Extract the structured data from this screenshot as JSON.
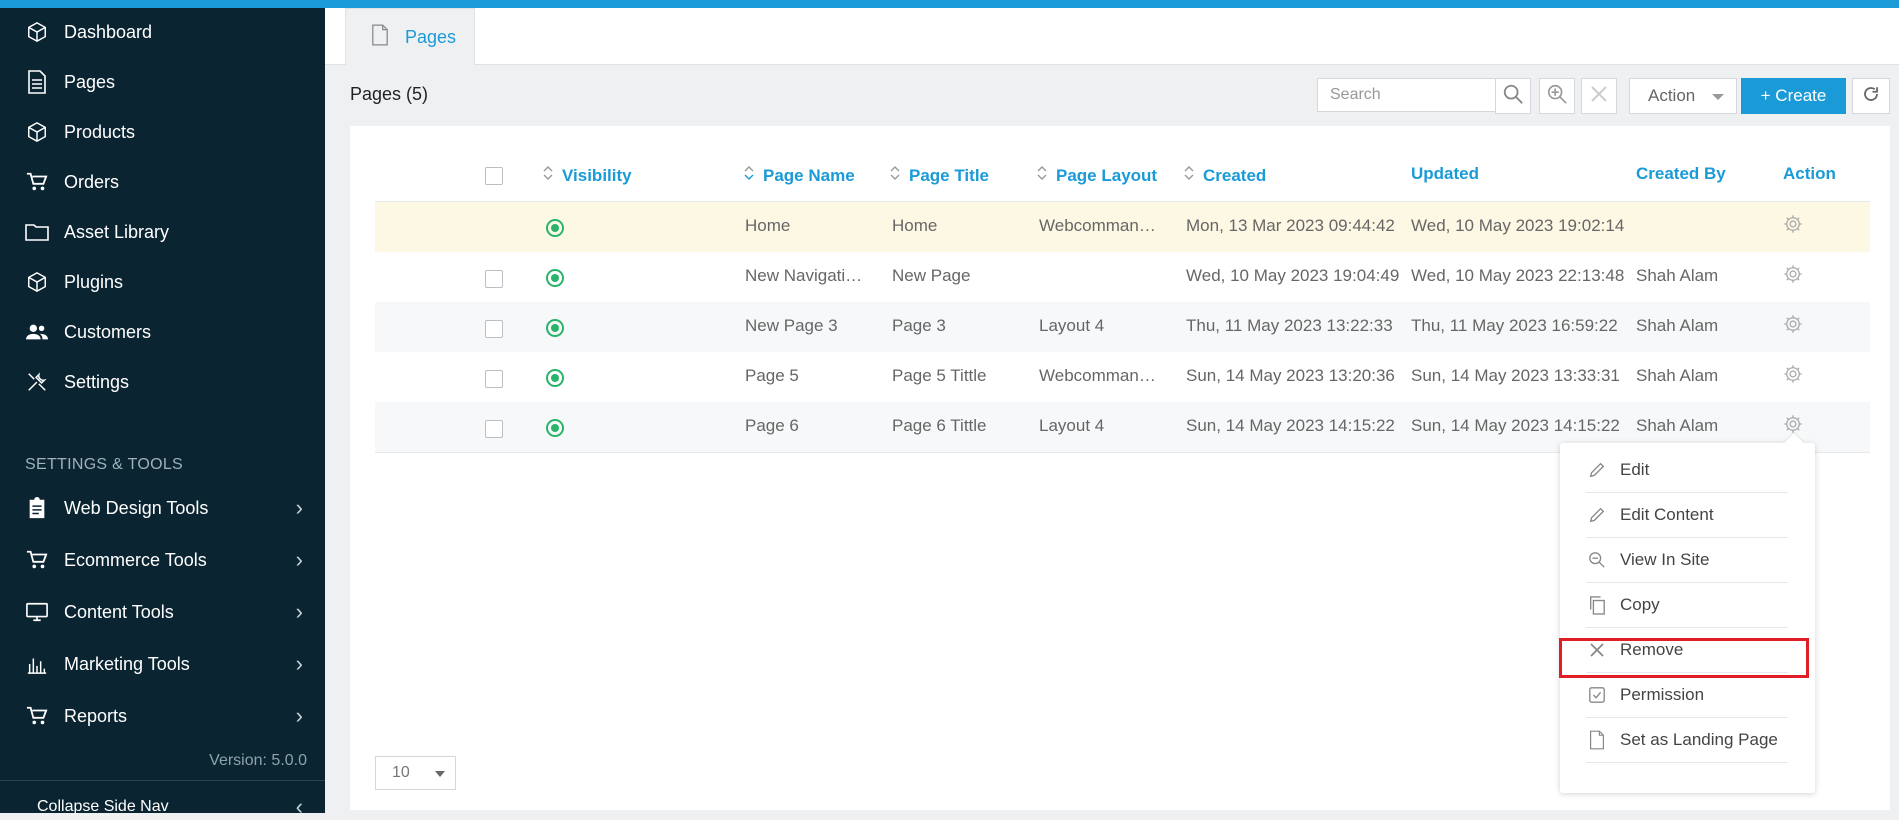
{
  "sidebar": {
    "items": [
      {
        "label": "Dashboard",
        "icon": "cube-icon"
      },
      {
        "label": "Pages",
        "icon": "page-icon"
      },
      {
        "label": "Products",
        "icon": "box-icon"
      },
      {
        "label": "Orders",
        "icon": "cart-icon"
      },
      {
        "label": "Asset Library",
        "icon": "folder-icon"
      },
      {
        "label": "Plugins",
        "icon": "cube-icon"
      },
      {
        "label": "Customers",
        "icon": "users-icon"
      },
      {
        "label": "Settings",
        "icon": "tools-icon"
      }
    ],
    "section_title": "SETTINGS & TOOLS",
    "tools": [
      {
        "label": "Web Design Tools",
        "icon": "clipboard-icon"
      },
      {
        "label": "Ecommerce Tools",
        "icon": "cart-icon"
      },
      {
        "label": "Content Tools",
        "icon": "monitor-icon"
      },
      {
        "label": "Marketing Tools",
        "icon": "chart-icon"
      },
      {
        "label": "Reports",
        "icon": "cart-icon"
      }
    ],
    "version": "Version: 5.0.0",
    "collapse_label": "Collapse Side Nav"
  },
  "tab": {
    "label": "Pages"
  },
  "header": {
    "count_label": "Pages (5)",
    "search_placeholder": "Search",
    "action_label": "Action",
    "create_label": "+  Create"
  },
  "table": {
    "columns": {
      "visibility": "Visibility",
      "page_name": "Page Name",
      "page_title": "Page Title",
      "page_layout": "Page Layout",
      "created": "Created",
      "updated": "Updated",
      "created_by": "Created By",
      "action": "Action"
    },
    "rows": [
      {
        "page_name": "Home",
        "page_title": "Home",
        "page_layout": "Webcomman…",
        "created": "Mon, 13 Mar 2023 09:44:42",
        "updated": "Wed, 10 May 2023 19:02:14",
        "created_by": ""
      },
      {
        "page_name": "New Navigati…",
        "page_title": "New Page",
        "page_layout": "",
        "created": "Wed, 10 May 2023 19:04:49",
        "updated": "Wed, 10 May 2023 22:13:48",
        "created_by": "Shah Alam"
      },
      {
        "page_name": "New Page 3",
        "page_title": "Page 3",
        "page_layout": "Layout 4",
        "created": "Thu, 11 May 2023 13:22:33",
        "updated": "Thu, 11 May 2023 16:59:22",
        "created_by": "Shah Alam"
      },
      {
        "page_name": "Page 5",
        "page_title": "Page 5 Tittle",
        "page_layout": "Webcomman…",
        "created": "Sun, 14 May 2023 13:20:36",
        "updated": "Sun, 14 May 2023 13:33:31",
        "created_by": "Shah Alam"
      },
      {
        "page_name": "Page 6",
        "page_title": "Page 6 Tittle",
        "page_layout": "Layout 4",
        "created": "Sun, 14 May 2023 14:15:22",
        "updated": "Sun, 14 May 2023 14:15:22",
        "created_by": "Shah Alam"
      }
    ]
  },
  "menu": {
    "items": [
      {
        "label": "Edit",
        "icon": "pencil-icon"
      },
      {
        "label": "Edit Content",
        "icon": "pencil-icon"
      },
      {
        "label": "View In Site",
        "icon": "search-doc-icon"
      },
      {
        "label": "Copy",
        "icon": "copy-icon"
      },
      {
        "label": "Remove",
        "icon": "close-icon"
      },
      {
        "label": "Permission",
        "icon": "check-box-icon"
      },
      {
        "label": "Set as Landing Page",
        "icon": "page-icon"
      }
    ]
  },
  "pager": {
    "page_size": "10"
  },
  "colors": {
    "accent": "#1a9bd7",
    "sidebar_bg": "#0b2431",
    "highlight_row": "#fdf8e4",
    "visible_green": "#29b36b",
    "highlight_border": "#e01e25"
  }
}
